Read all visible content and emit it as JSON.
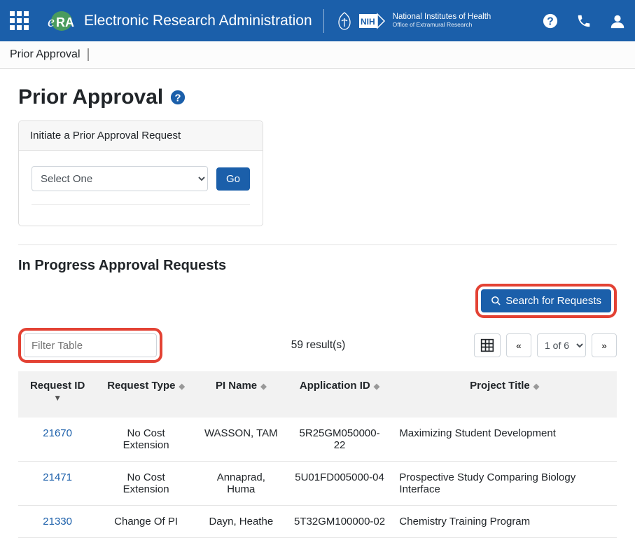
{
  "header": {
    "app_title": "Electronic Research Administration",
    "nih_title": "National Institutes of Health",
    "nih_sub": "Office of Extramural Research"
  },
  "breadcrumb": "Prior Approval",
  "page": {
    "title": "Prior Approval",
    "initiate_label": "Initiate a Prior Approval Request",
    "select_placeholder": "Select One",
    "go_label": "Go",
    "section_title": "In Progress Approval Requests",
    "search_button": "Search for Requests",
    "filter_placeholder": "Filter Table",
    "results_text": "59 result(s)",
    "page_label": "1 of 6"
  },
  "table": {
    "columns": {
      "request_id": "Request ID",
      "request_type": "Request Type",
      "pi_name": "PI Name",
      "application_id": "Application ID",
      "project_title": "Project Title"
    },
    "rows": [
      {
        "id": "21670",
        "type": "No Cost Extension",
        "pi": "WASSON, TAM",
        "app": "5R25GM050000-22",
        "title": "Maximizing Student Development"
      },
      {
        "id": "21471",
        "type": "No Cost Extension",
        "pi": "Annaprad, Huma",
        "app": "5U01FD005000-04",
        "title": "Prospective Study Comparing Biology Interface"
      },
      {
        "id": "21330",
        "type": "Change Of PI",
        "pi": "Dayn, Heathe",
        "app": "5T32GM100000-02",
        "title": "Chemistry Training Program"
      }
    ]
  }
}
